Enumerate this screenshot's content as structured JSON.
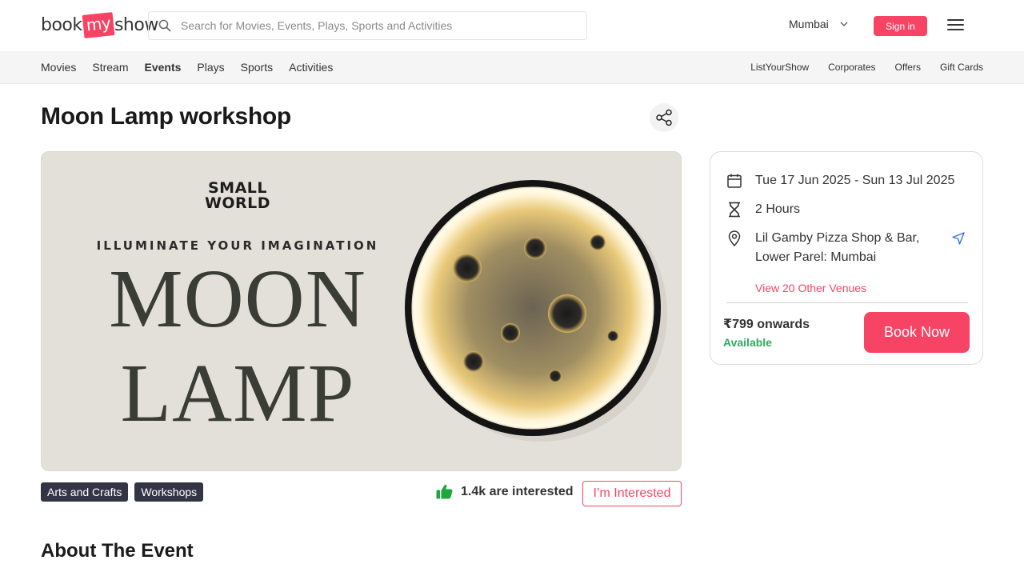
{
  "header": {
    "logo": {
      "part1": "book",
      "part2": "my",
      "part3": "show"
    },
    "search_placeholder": "Search for Movies, Events, Plays, Sports and Activities",
    "city": "Mumbai",
    "signin_label": "Sign in"
  },
  "nav": {
    "left": [
      "Movies",
      "Stream",
      "Events",
      "Plays",
      "Sports",
      "Activities"
    ],
    "active": "Events",
    "right": [
      "ListYourShow",
      "Corporates",
      "Offers",
      "Gift Cards"
    ]
  },
  "event": {
    "title": "Moon Lamp workshop",
    "banner": {
      "brand_line1": "SMALL",
      "brand_line2": "WORLD",
      "tagline": "ILLUMINATE YOUR IMAGINATION",
      "word1": "MOON",
      "word2": "LAMP"
    },
    "tags": [
      "Arts and Crafts",
      "Workshops"
    ],
    "interest_count": "1.4k are interested",
    "interested_label": "I’m Interested",
    "about_heading": "About The Event"
  },
  "booking": {
    "dates": "Tue 17 Jun 2025 - Sun 13 Jul 2025",
    "duration": "2 Hours",
    "venue_line1": "Lil Gamby Pizza Shop & Bar,",
    "venue_line2": "Lower Parel: Mumbai",
    "other_venues": "View 20 Other Venues",
    "price": "₹799 onwards",
    "availability": "Available",
    "book_label": "Book Now"
  },
  "colors": {
    "brand": "#f84464",
    "tag_bg": "#333545",
    "available": "#2dab5e",
    "nav_bg": "#f5f5f5"
  },
  "icons": [
    "search-icon",
    "chevron-down-icon",
    "hamburger-icon",
    "share-icon",
    "thumbs-up-icon",
    "calendar-icon",
    "hourglass-icon",
    "location-pin-icon",
    "navigation-arrow-icon"
  ]
}
